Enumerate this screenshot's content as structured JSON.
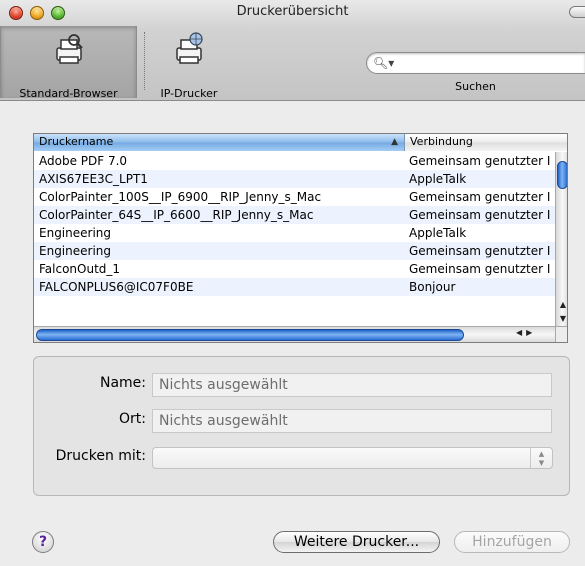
{
  "window": {
    "title": "Druckerübersicht"
  },
  "toolbar": {
    "standard_browser_label": "Standard-Browser",
    "ip_printer_label": "IP-Drucker",
    "search_label": "Suchen",
    "search_placeholder": "",
    "search_icon": "magnifier-icon"
  },
  "table": {
    "columns": [
      "Druckername",
      "Verbindung"
    ],
    "sorted_column": "Druckername",
    "rows": [
      {
        "name": "Adobe PDF 7.0",
        "connection": "Gemeinsam genutzter I"
      },
      {
        "name": "AXIS67EE3C_LPT1",
        "connection": "AppleTalk"
      },
      {
        "name": "ColorPainter_100S__IP_6900__RIP_Jenny_s_Mac",
        "connection": "Gemeinsam genutzter I"
      },
      {
        "name": "ColorPainter_64S__IP_6600__RIP_Jenny_s_Mac",
        "connection": "Gemeinsam genutzter I"
      },
      {
        "name": "Engineering",
        "connection": "AppleTalk"
      },
      {
        "name": "Engineering",
        "connection": "Gemeinsam genutzter I"
      },
      {
        "name": "FalconOutd_1",
        "connection": "Gemeinsam genutzter I"
      },
      {
        "name": "FALCONPLUS6@IC07F0BE",
        "connection": "Bonjour"
      }
    ]
  },
  "details": {
    "name_label": "Name:",
    "name_value": "Nichts ausgewählt",
    "location_label": "Ort:",
    "location_value": "Nichts ausgewählt",
    "print_with_label": "Drucken mit:",
    "print_with_value": ""
  },
  "buttons": {
    "help": "?",
    "more_printers": "Weitere Drucker...",
    "add": "Hinzufügen"
  },
  "colors": {
    "selection_header": "#8ab9ea",
    "scroll_thumb": "#2a6ed4",
    "help_glyph": "#5a1f9a"
  }
}
